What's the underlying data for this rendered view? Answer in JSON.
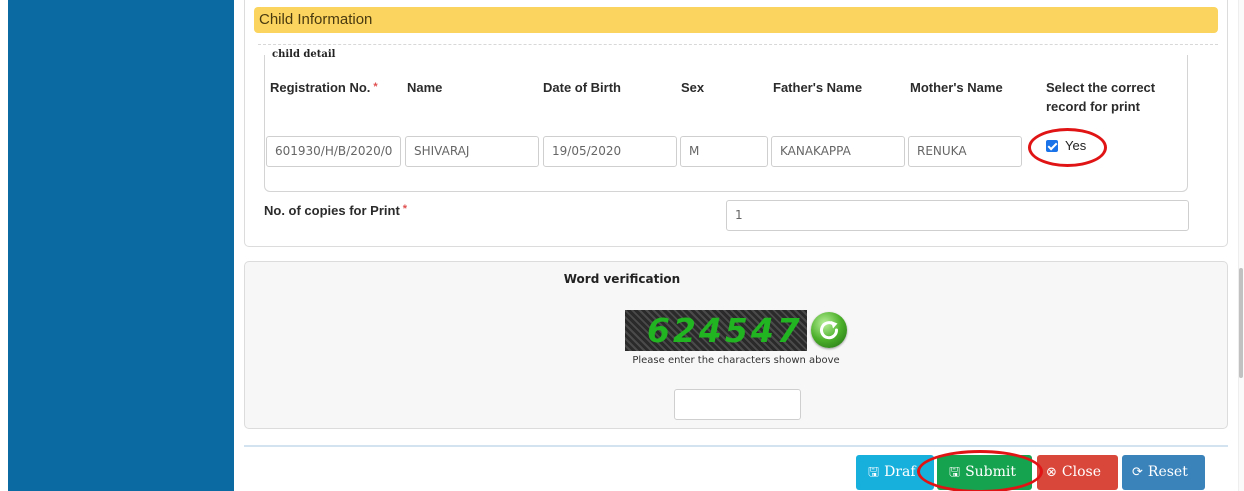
{
  "section": {
    "title": "Child Information",
    "fieldset_legend": "child detail"
  },
  "child_detail": {
    "columns": [
      "Registration No.",
      "Name",
      "Date of Birth",
      "Sex",
      "Father's Name",
      "Mother's Name",
      "Select the correct record for print"
    ],
    "required_marker": "*",
    "record": {
      "registration_no": "601930/H/B/2020/0",
      "name": "SHIVARAJ",
      "date_of_birth": "19/05/2020",
      "sex": "M",
      "fathers_name": "KANAKAPPA",
      "mothers_name": "RENUKA",
      "select_checked": true,
      "select_label": "Yes"
    }
  },
  "copies": {
    "label": "No. of copies for Print",
    "value": "1"
  },
  "verification": {
    "title": "Word verification",
    "captcha_text": "624547",
    "hint": "Please enter the characters shown above",
    "input_value": ""
  },
  "buttons": {
    "draft": "Draf",
    "submit": "Submit",
    "close": "Close",
    "reset": "Reset"
  },
  "colors": {
    "sidebar": "#0a6aa1",
    "section_header": "#fad45e",
    "draft": "#17b0dd",
    "submit": "#16a34f",
    "close": "#d9473b",
    "reset": "#3982ba",
    "highlight": "#e01414"
  },
  "icons": {
    "draft": "floppy-disk-icon",
    "submit": "floppy-disk-icon",
    "close": "times-circle-icon",
    "reset": "refresh-icon",
    "captcha_refresh": "refresh-arrow-icon"
  }
}
